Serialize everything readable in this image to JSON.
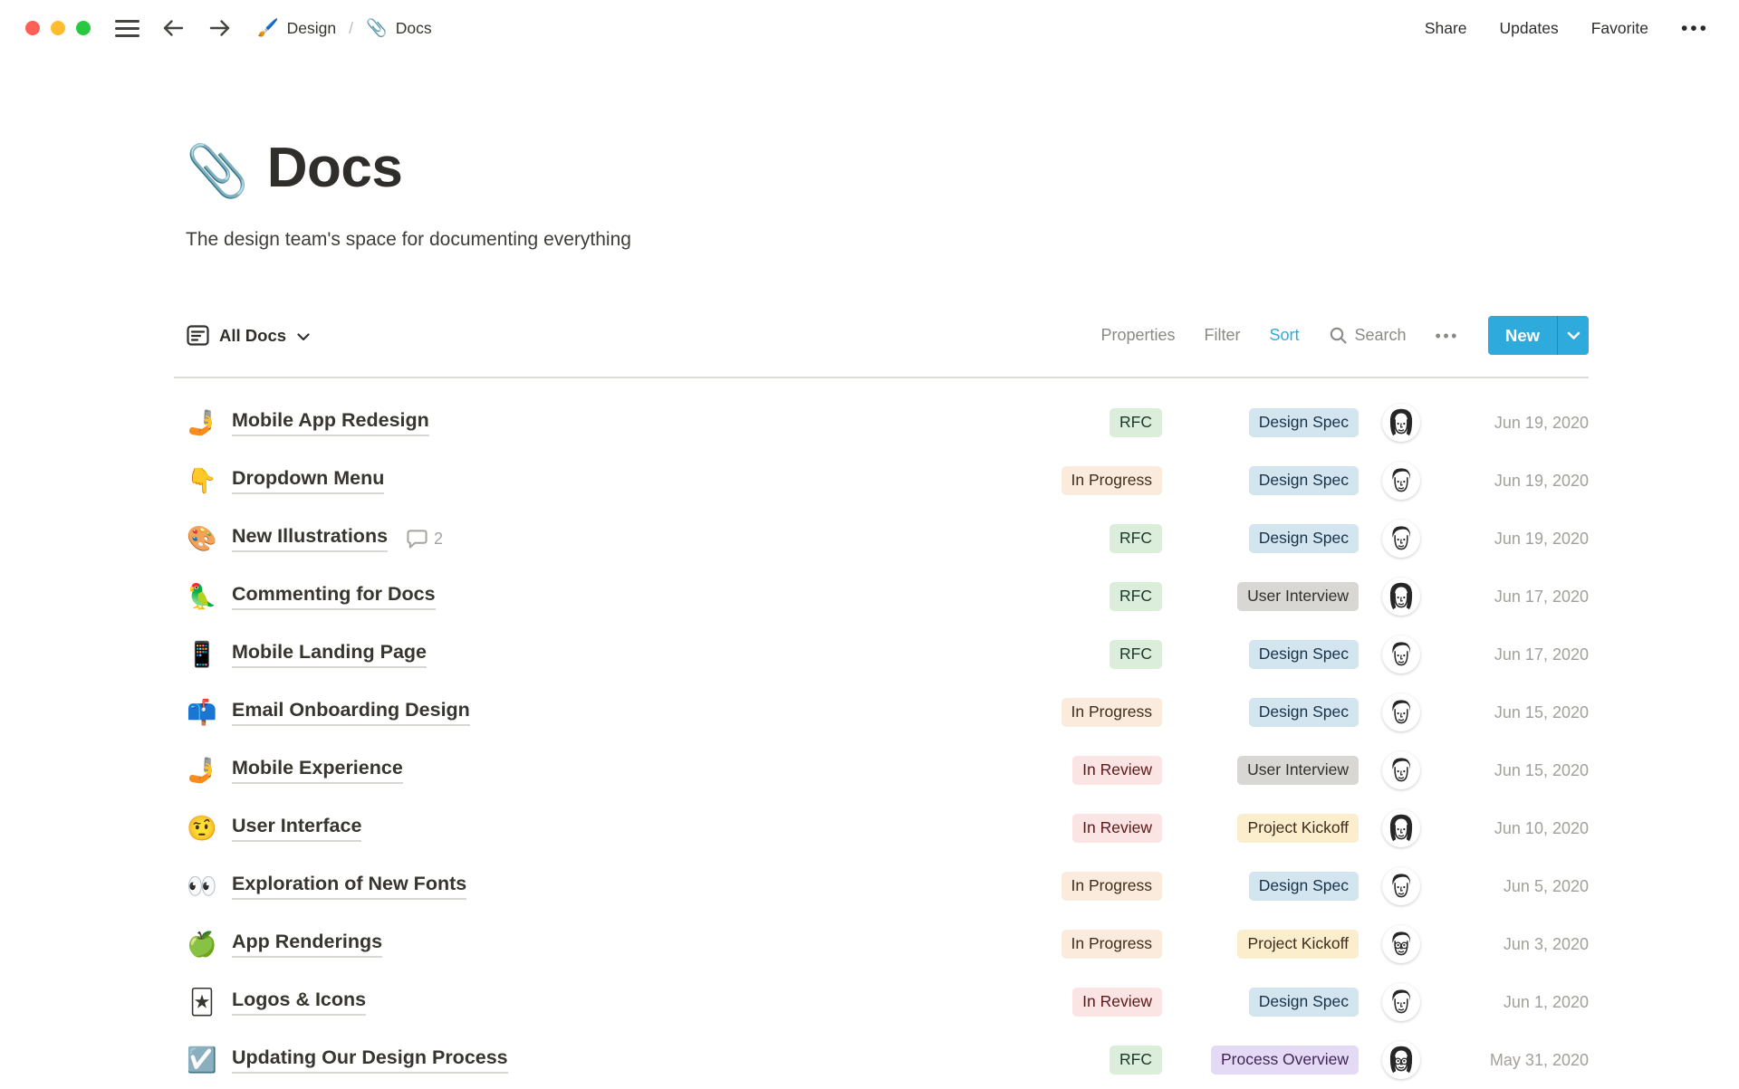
{
  "window": {
    "traffic_lights": [
      "close",
      "minimize",
      "zoom"
    ],
    "breadcrumb": {
      "items": [
        {
          "emoji": "🖌️",
          "label": "Design"
        },
        {
          "emoji": "📎",
          "label": "Docs"
        }
      ],
      "separator": "/"
    },
    "actions": {
      "share": "Share",
      "updates": "Updates",
      "favorite": "Favorite",
      "more": "•••"
    }
  },
  "page": {
    "emoji": "📎",
    "title": "Docs",
    "subtitle": "The design team's space for documenting everything"
  },
  "toolbar": {
    "view_label": "All Docs",
    "properties": "Properties",
    "filter": "Filter",
    "sort": "Sort",
    "search": "Search",
    "more": "•••",
    "new_label": "New"
  },
  "table": {
    "rows": [
      {
        "emoji": "🤳",
        "title": "Mobile App Redesign",
        "comments": null,
        "status": "RFC",
        "type": "Design Spec",
        "avatar": "woman",
        "date": "Jun 19, 2020"
      },
      {
        "emoji": "👇",
        "title": "Dropdown Menu",
        "comments": null,
        "status": "In Progress",
        "type": "Design Spec",
        "avatar": "man",
        "date": "Jun 19, 2020"
      },
      {
        "emoji": "🎨",
        "title": "New Illustrations",
        "comments": "2",
        "status": "RFC",
        "type": "Design Spec",
        "avatar": "man",
        "date": "Jun 19, 2020"
      },
      {
        "emoji": "🦜",
        "title": "Commenting for Docs",
        "comments": null,
        "status": "RFC",
        "type": "User Interview",
        "avatar": "woman",
        "date": "Jun 17, 2020"
      },
      {
        "emoji": "📱",
        "title": "Mobile Landing Page",
        "comments": null,
        "status": "RFC",
        "type": "Design Spec",
        "avatar": "man",
        "date": "Jun 17, 2020"
      },
      {
        "emoji": "📫",
        "title": "Email Onboarding Design",
        "comments": null,
        "status": "In Progress",
        "type": "Design Spec",
        "avatar": "man",
        "date": "Jun 15, 2020"
      },
      {
        "emoji": "🤳",
        "title": "Mobile Experience",
        "comments": null,
        "status": "In Review",
        "type": "User Interview",
        "avatar": "man",
        "date": "Jun 15, 2020"
      },
      {
        "emoji": "🤨",
        "title": "User Interface",
        "comments": null,
        "status": "In Review",
        "type": "Project Kickoff",
        "avatar": "woman",
        "date": "Jun 10, 2020"
      },
      {
        "emoji": "👀",
        "title": "Exploration of New Fonts",
        "comments": null,
        "status": "In Progress",
        "type": "Design Spec",
        "avatar": "man",
        "date": "Jun 5, 2020"
      },
      {
        "emoji": "🍏",
        "title": "App Renderings",
        "comments": null,
        "status": "In Progress",
        "type": "Project Kickoff",
        "avatar": "man-glasses",
        "date": "Jun 3, 2020"
      },
      {
        "emoji": "🃏",
        "title": "Logos & Icons",
        "comments": null,
        "status": "In Review",
        "type": "Design Spec",
        "avatar": "man",
        "date": "Jun 1, 2020"
      },
      {
        "emoji": "☑️",
        "title": "Updating Our Design Process",
        "comments": null,
        "status": "RFC",
        "type": "Process Overview",
        "avatar": "woman-glasses",
        "date": "May 31, 2020"
      }
    ]
  },
  "colors": {
    "accent": "#2EAADC",
    "tags": {
      "RFC": {
        "bg": "#DBEDDB",
        "fg": "#1C3829"
      },
      "In Progress": {
        "bg": "#FAEBDD",
        "fg": "#402C1B"
      },
      "In Review": {
        "bg": "#FBE4E4",
        "fg": "#5D1715"
      },
      "Design Spec": {
        "bg": "#D3E5EF",
        "fg": "#183347"
      },
      "User Interview": {
        "bg": "#D8D7D4",
        "fg": "#32302C"
      },
      "Project Kickoff": {
        "bg": "#FBEECC",
        "fg": "#402C1B"
      },
      "Process Overview": {
        "bg": "#E4DAF6",
        "fg": "#412454"
      }
    }
  }
}
